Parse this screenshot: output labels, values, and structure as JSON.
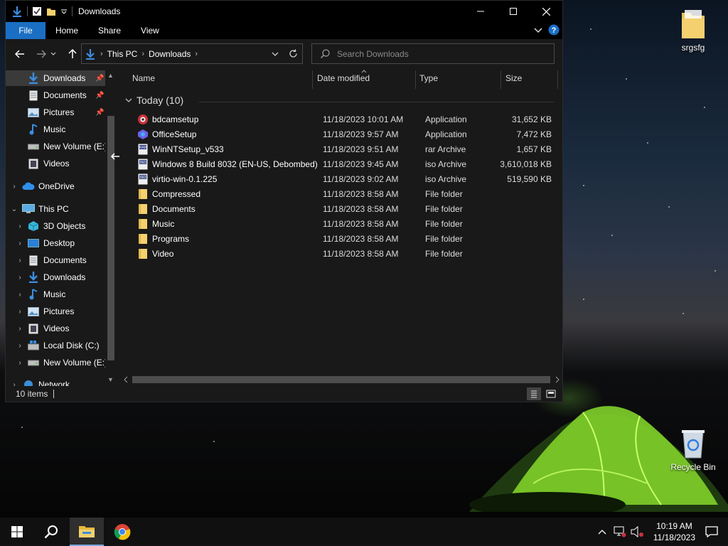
{
  "window": {
    "title": "Downloads",
    "ribbon_tabs": [
      "File",
      "Home",
      "Share",
      "View"
    ]
  },
  "address": {
    "crumbs": [
      "This PC",
      "Downloads"
    ]
  },
  "search": {
    "placeholder": "Search Downloads"
  },
  "nav": {
    "quick_access": [
      {
        "label": "Downloads",
        "icon": "download-arrow-icon",
        "pinned": true,
        "selected": true
      },
      {
        "label": "Documents",
        "icon": "document-icon",
        "pinned": true
      },
      {
        "label": "Pictures",
        "icon": "picture-icon",
        "pinned": true
      },
      {
        "label": "Music",
        "icon": "music-note-icon"
      },
      {
        "label": "New Volume (E:)",
        "icon": "drive-icon"
      },
      {
        "label": "Videos",
        "icon": "video-icon"
      }
    ],
    "onedrive": "OneDrive",
    "this_pc": "This PC",
    "pc_children": [
      {
        "label": "3D Objects",
        "icon": "cube-icon"
      },
      {
        "label": "Desktop",
        "icon": "desktop-icon"
      },
      {
        "label": "Documents",
        "icon": "document-icon"
      },
      {
        "label": "Downloads",
        "icon": "download-arrow-icon"
      },
      {
        "label": "Music",
        "icon": "music-note-icon"
      },
      {
        "label": "Pictures",
        "icon": "picture-icon"
      },
      {
        "label": "Videos",
        "icon": "video-icon"
      },
      {
        "label": "Local Disk (C:)",
        "icon": "windows-drive-icon"
      },
      {
        "label": "New Volume (E:)",
        "icon": "drive-icon"
      }
    ],
    "network": "Network"
  },
  "columns": {
    "name": "Name",
    "date": "Date modified",
    "type": "Type",
    "size": "Size"
  },
  "group": {
    "label": "Today (10)"
  },
  "files": [
    {
      "name": "bdcamsetup",
      "date": "11/18/2023 10:01 AM",
      "type": "Application",
      "size": "31,652 KB",
      "icon": "bandicam-icon"
    },
    {
      "name": "OfficeSetup",
      "date": "11/18/2023 9:57 AM",
      "type": "Application",
      "size": "7,472 KB",
      "icon": "office-icon"
    },
    {
      "name": "WinNTSetup_v533",
      "date": "11/18/2023 9:51 AM",
      "type": "rar Archive",
      "size": "1,657 KB",
      "icon": "rar-archive-icon"
    },
    {
      "name": "Windows 8 Build 8032 (EN-US, Debombed)",
      "date": "11/18/2023 9:45 AM",
      "type": "iso Archive",
      "size": "3,610,018 KB",
      "icon": "iso-archive-icon"
    },
    {
      "name": "virtio-win-0.1.225",
      "date": "11/18/2023 9:02 AM",
      "type": "iso Archive",
      "size": "519,590 KB",
      "icon": "iso-archive-icon"
    },
    {
      "name": "Compressed",
      "date": "11/18/2023 8:58 AM",
      "type": "File folder",
      "size": "",
      "icon": "folder-icon"
    },
    {
      "name": "Documents",
      "date": "11/18/2023 8:58 AM",
      "type": "File folder",
      "size": "",
      "icon": "folder-icon"
    },
    {
      "name": "Music",
      "date": "11/18/2023 8:58 AM",
      "type": "File folder",
      "size": "",
      "icon": "folder-icon"
    },
    {
      "name": "Programs",
      "date": "11/18/2023 8:58 AM",
      "type": "File folder",
      "size": "",
      "icon": "folder-icon"
    },
    {
      "name": "Video",
      "date": "11/18/2023 8:58 AM",
      "type": "File folder",
      "size": "",
      "icon": "folder-icon"
    }
  ],
  "status": {
    "items": "10 items"
  },
  "desktop": {
    "folder_label": "srgsfg",
    "recycle_label": "Recycle Bin"
  },
  "taskbar": {
    "time": "10:19 AM",
    "date": "11/18/2023"
  },
  "colors": {
    "accent": "#1a6fc4",
    "folder": "#f4d06f",
    "download_arrow": "#3b8de0"
  }
}
